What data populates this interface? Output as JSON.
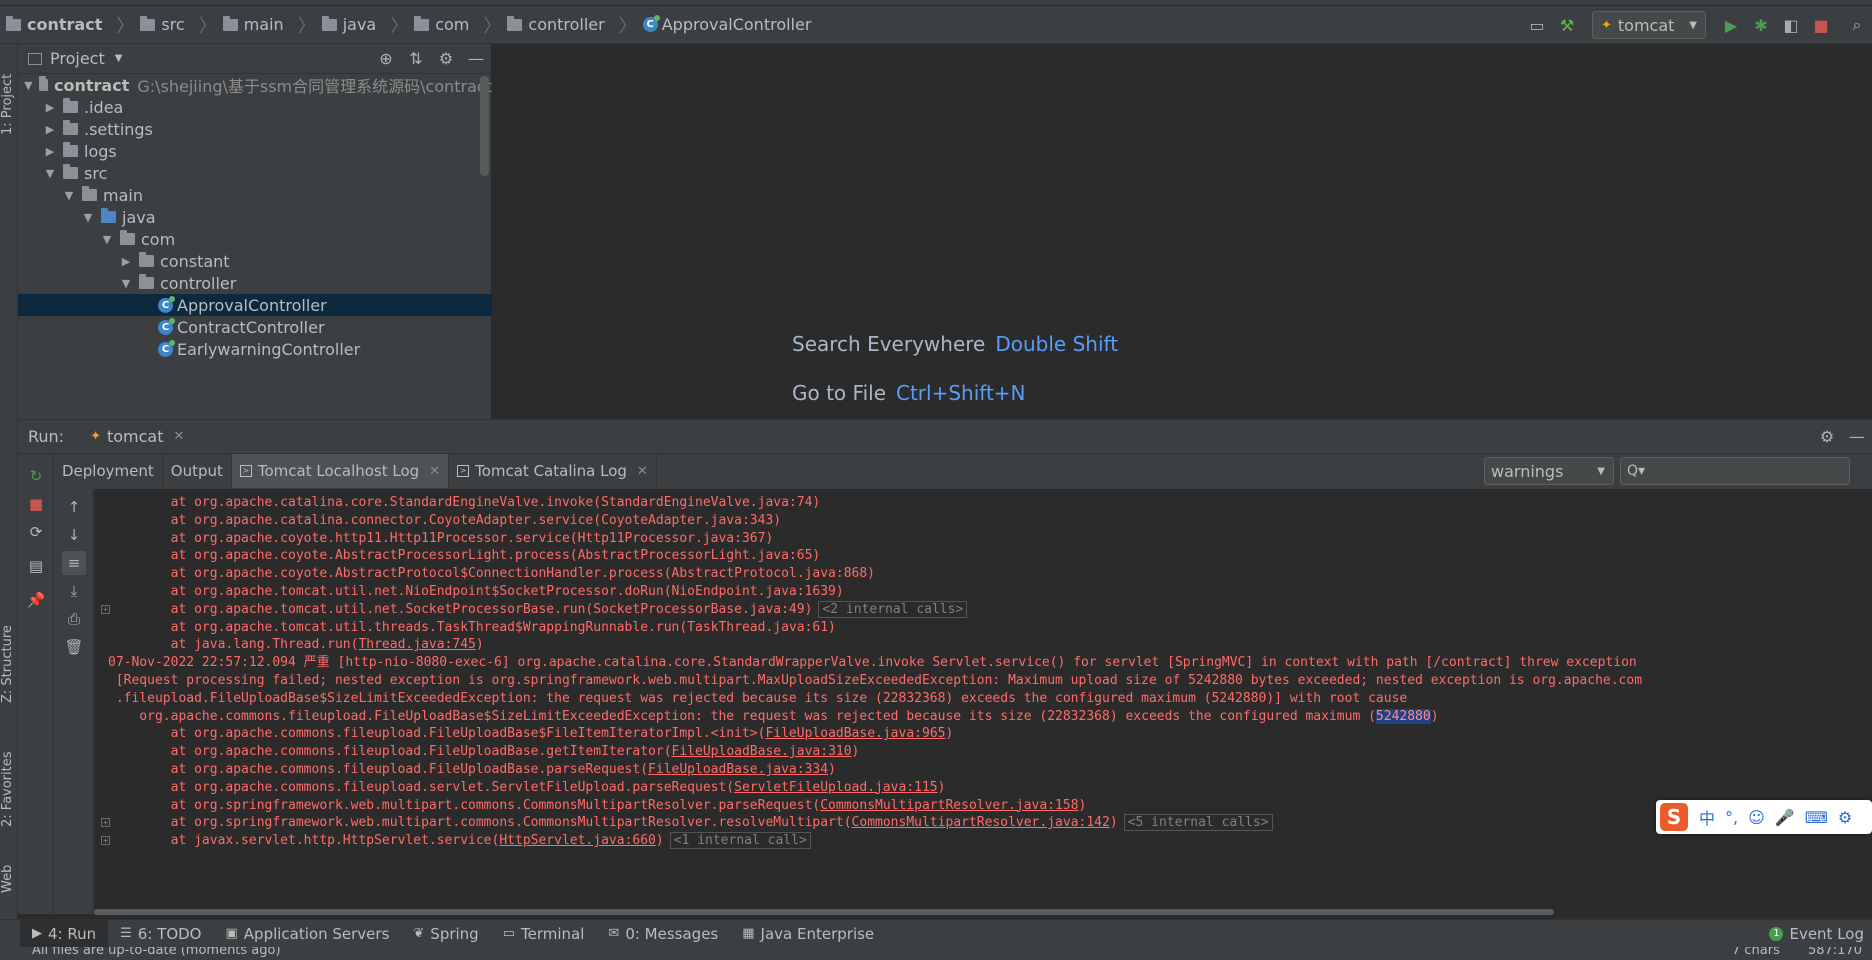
{
  "navbar": {
    "crumbs": [
      "contract",
      "src",
      "main",
      "java",
      "com",
      "controller",
      "ApprovalController"
    ],
    "run_config": "tomcat"
  },
  "left_stripe": {
    "project": "1: Project",
    "structure": "Z: Structure",
    "favorites": "2: Favorites",
    "web": "Web"
  },
  "project_panel": {
    "title": "Project",
    "tree": [
      {
        "label": "contract",
        "path": "G:\\shejiing\\基于ssm合同管理系统源码\\contract",
        "indent": 0,
        "arrow": "▼",
        "icon": "folder-icon"
      },
      {
        "label": ".idea",
        "indent": 1,
        "arrow": "▶",
        "icon": "folder-icon"
      },
      {
        "label": ".settings",
        "indent": 1,
        "arrow": "▶",
        "icon": "folder-icon"
      },
      {
        "label": "logs",
        "indent": 1,
        "arrow": "▶",
        "icon": "folder-icon"
      },
      {
        "label": "src",
        "indent": 1,
        "arrow": "▼",
        "icon": "folder-icon"
      },
      {
        "label": "main",
        "indent": 2,
        "arrow": "▼",
        "icon": "folder-icon"
      },
      {
        "label": "java",
        "indent": 3,
        "arrow": "▼",
        "icon": "folder-blue-icon"
      },
      {
        "label": "com",
        "indent": 4,
        "arrow": "▼",
        "icon": "package-icon"
      },
      {
        "label": "constant",
        "indent": 5,
        "arrow": "▶",
        "icon": "package-icon"
      },
      {
        "label": "controller",
        "indent": 5,
        "arrow": "▼",
        "icon": "package-icon"
      },
      {
        "label": "ApprovalController",
        "indent": 6,
        "arrow": "",
        "icon": "class-icon",
        "selected": true
      },
      {
        "label": "ContractController",
        "indent": 6,
        "arrow": "",
        "icon": "class-icon"
      },
      {
        "label": "EarlywarningController",
        "indent": 6,
        "arrow": "",
        "icon": "class-icon"
      }
    ]
  },
  "editor": {
    "hint1_label": "Search Everywhere",
    "hint1_key": "Double Shift",
    "hint2_label": "Go to File",
    "hint2_key": "Ctrl+Shift+N"
  },
  "run_window": {
    "label": "Run:",
    "tab": "tomcat",
    "subtabs": [
      "Deployment",
      "Output",
      "Tomcat Localhost Log",
      "Tomcat Catalina Log"
    ],
    "filter_value": "warnings",
    "search_glyph": "Q▾"
  },
  "console_lines": [
    {
      "pre": "        at org.apache.catalina.core.StandardEngineValve.invoke(StandardEngineValve.java:74)"
    },
    {
      "pre": "        at org.apache.catalina.connector.CoyoteAdapter.service(CoyoteAdapter.java:343)"
    },
    {
      "pre": "        at org.apache.coyote.http11.Http11Processor.service(Http11Processor.java:367)"
    },
    {
      "pre": "        at org.apache.coyote.AbstractProcessorLight.process(AbstractProcessorLight.java:65)"
    },
    {
      "pre": "        at org.apache.coyote.AbstractProtocol$ConnectionHandler.process(AbstractProtocol.java:868)"
    },
    {
      "pre": "        at org.apache.tomcat.util.net.NioEndpoint$SocketProcessor.doRun(NioEndpoint.java:1639)"
    },
    {
      "pre": "        at org.apache.tomcat.util.net.SocketProcessorBase.run(SocketProcessorBase.java:49)",
      "dim": "<2 internal calls>",
      "fold": true
    },
    {
      "pre": "        at org.apache.tomcat.util.threads.TaskThread$WrappingRunnable.run(TaskThread.java:61)"
    },
    {
      "pre": "        at java.lang.Thread.run(",
      "link": "Thread.java:745",
      "post": ")"
    },
    {
      "pre": "07-Nov-2022 22:57:12.094 严重 [http-nio-8080-exec-6] org.apache.catalina.core.StandardWrapperValve.invoke Servlet.service() for servlet [SpringMVC] in context with path [/contract] threw exception"
    },
    {
      "pre": " [Request processing failed; nested exception is org.springframework.web.multipart.MaxUploadSizeExceededException: Maximum upload size of 5242880 bytes exceeded; nested exception is org.apache.com"
    },
    {
      "pre": " .fileupload.FileUploadBase$SizeLimitExceededException: the request was rejected because its size (22832368) exceeds the configured maximum (5242880)] with root cause"
    },
    {
      "pre": "    org.apache.commons.fileupload.FileUploadBase$SizeLimitExceededException: the request was rejected because its size (22832368) exceeds the configured maximum (",
      "hl": "5242880",
      "post": ")"
    },
    {
      "pre": "        at org.apache.commons.fileupload.FileUploadBase$FileItemIteratorImpl.<init>(",
      "link": "FileUploadBase.java:965",
      "post": ")"
    },
    {
      "pre": "        at org.apache.commons.fileupload.FileUploadBase.getItemIterator(",
      "link": "FileUploadBase.java:310",
      "post": ")"
    },
    {
      "pre": "        at org.apache.commons.fileupload.FileUploadBase.parseRequest(",
      "link": "FileUploadBase.java:334",
      "post": ")"
    },
    {
      "pre": "        at org.apache.commons.fileupload.servlet.ServletFileUpload.parseRequest(",
      "link": "ServletFileUpload.java:115",
      "post": ")"
    },
    {
      "pre": "        at org.springframework.web.multipart.commons.CommonsMultipartResolver.parseRequest(",
      "link": "CommonsMultipartResolver.java:158",
      "post": ")"
    },
    {
      "pre": "        at org.springframework.web.multipart.commons.CommonsMultipartResolver.resolveMultipart(",
      "link": "CommonsMultipartResolver.java:142",
      "post": ")",
      "dim": "<5 internal calls>",
      "fold": true
    },
    {
      "pre": "        at javax.servlet.http.HttpServlet.service(",
      "link": "HttpServlet.java:660",
      "post": ")",
      "dim": "<1 internal call>",
      "fold": true
    }
  ],
  "ime": {
    "logo": "S",
    "lang": "中",
    "punct": "°,",
    "emoji": "☺",
    "mic": "🎤",
    "kbd": "⌨",
    "more": "⚙"
  },
  "bottom_tools": [
    {
      "label": "4: Run",
      "icon": "▶",
      "active": true
    },
    {
      "label": "6: TODO",
      "icon": "☰"
    },
    {
      "label": "Application Servers",
      "icon": "▣"
    },
    {
      "label": "Spring",
      "icon": "❦"
    },
    {
      "label": "Terminal",
      "icon": "▭"
    },
    {
      "label": "0: Messages",
      "icon": "✉"
    },
    {
      "label": "Java Enterprise",
      "icon": "▦"
    }
  ],
  "event_log": {
    "count": "1",
    "label": "Event Log"
  },
  "status_bar": {
    "message": "All files are up-to-date (moments ago)",
    "chars": "7 chars",
    "position": "587:170"
  }
}
